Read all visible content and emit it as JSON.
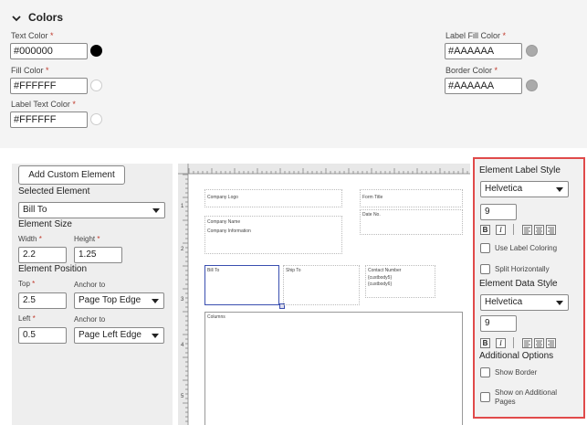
{
  "colors": {
    "section_title": "Colors",
    "required_mark": "*",
    "text_color": {
      "label": "Text Color",
      "value": "#000000",
      "swatch": "#000000"
    },
    "fill_color": {
      "label": "Fill Color",
      "value": "#FFFFFF",
      "swatch": "#FFFFFF"
    },
    "label_text_color": {
      "label": "Label Text Color",
      "value": "#FFFFFF",
      "swatch": "#FFFFFF"
    },
    "label_fill_color": {
      "label": "Label Fill Color",
      "value": "#AAAAAA",
      "swatch": "#AAAAAA"
    },
    "border_color": {
      "label": "Border Color",
      "value": "#AAAAAA",
      "swatch": "#AAAAAA"
    }
  },
  "left_panel": {
    "add_button": "Add Custom Element",
    "selected_element_heading": "Selected Element",
    "selected_element_value": "Bill To",
    "element_size_heading": "Element Size",
    "width_label": "Width",
    "width_value": "2.2",
    "height_label": "Height",
    "height_value": "1.25",
    "element_position_heading": "Element Position",
    "top_label": "Top",
    "top_value": "2.5",
    "top_anchor_label": "Anchor to",
    "top_anchor_value": "Page Top Edge",
    "left_label": "Left",
    "left_value": "0.5",
    "left_anchor_label": "Anchor to",
    "left_anchor_value": "Page Left Edge"
  },
  "canvas": {
    "ruler_numbers": [
      "1",
      "2",
      "3",
      "4",
      "5"
    ],
    "company_logo": "Company Logo",
    "form_title": "Form Title",
    "company_name": "Company Name",
    "company_information": "Company Information",
    "date_no": "Date No.",
    "bill_to": "Bill To",
    "ship_to": "Ship To",
    "contact_number": "Contact Number",
    "custbody_1": "{custbody5}",
    "custbody_2": "{custbody6}",
    "columns": "Columns"
  },
  "right_panel": {
    "label_style_heading": "Element Label Style",
    "label_font": "Helvetica",
    "label_size": "9",
    "bold": "B",
    "italic": "I",
    "use_label_coloring": "Use Label Coloring",
    "split_horizontally": "Split Horizontally",
    "data_style_heading": "Element Data Style",
    "data_font": "Helvetica",
    "data_size": "9",
    "additional_options_heading": "Additional Options",
    "show_border": "Show Border",
    "show_on_additional_pages": "Show on Additional Pages"
  },
  "accent_colors": {
    "highlight_border": "#e04a4a",
    "selection": "#3a4fb0"
  }
}
